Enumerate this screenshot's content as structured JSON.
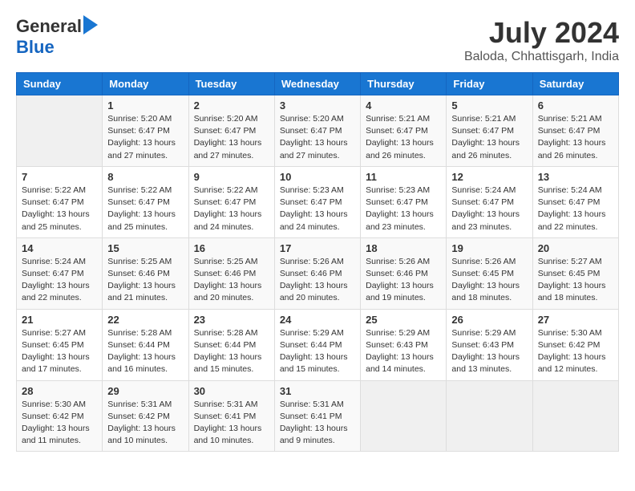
{
  "logo": {
    "general": "General",
    "blue": "Blue"
  },
  "title": {
    "month_year": "July 2024",
    "location": "Baloda, Chhattisgarh, India"
  },
  "calendar": {
    "headers": [
      "Sunday",
      "Monday",
      "Tuesday",
      "Wednesday",
      "Thursday",
      "Friday",
      "Saturday"
    ],
    "weeks": [
      [
        {
          "day": "",
          "sunrise": "",
          "sunset": "",
          "daylight": ""
        },
        {
          "day": "1",
          "sunrise": "Sunrise: 5:20 AM",
          "sunset": "Sunset: 6:47 PM",
          "daylight": "Daylight: 13 hours and 27 minutes."
        },
        {
          "day": "2",
          "sunrise": "Sunrise: 5:20 AM",
          "sunset": "Sunset: 6:47 PM",
          "daylight": "Daylight: 13 hours and 27 minutes."
        },
        {
          "day": "3",
          "sunrise": "Sunrise: 5:20 AM",
          "sunset": "Sunset: 6:47 PM",
          "daylight": "Daylight: 13 hours and 27 minutes."
        },
        {
          "day": "4",
          "sunrise": "Sunrise: 5:21 AM",
          "sunset": "Sunset: 6:47 PM",
          "daylight": "Daylight: 13 hours and 26 minutes."
        },
        {
          "day": "5",
          "sunrise": "Sunrise: 5:21 AM",
          "sunset": "Sunset: 6:47 PM",
          "daylight": "Daylight: 13 hours and 26 minutes."
        },
        {
          "day": "6",
          "sunrise": "Sunrise: 5:21 AM",
          "sunset": "Sunset: 6:47 PM",
          "daylight": "Daylight: 13 hours and 26 minutes."
        }
      ],
      [
        {
          "day": "7",
          "sunrise": "Sunrise: 5:22 AM",
          "sunset": "Sunset: 6:47 PM",
          "daylight": "Daylight: 13 hours and 25 minutes."
        },
        {
          "day": "8",
          "sunrise": "Sunrise: 5:22 AM",
          "sunset": "Sunset: 6:47 PM",
          "daylight": "Daylight: 13 hours and 25 minutes."
        },
        {
          "day": "9",
          "sunrise": "Sunrise: 5:22 AM",
          "sunset": "Sunset: 6:47 PM",
          "daylight": "Daylight: 13 hours and 24 minutes."
        },
        {
          "day": "10",
          "sunrise": "Sunrise: 5:23 AM",
          "sunset": "Sunset: 6:47 PM",
          "daylight": "Daylight: 13 hours and 24 minutes."
        },
        {
          "day": "11",
          "sunrise": "Sunrise: 5:23 AM",
          "sunset": "Sunset: 6:47 PM",
          "daylight": "Daylight: 13 hours and 23 minutes."
        },
        {
          "day": "12",
          "sunrise": "Sunrise: 5:24 AM",
          "sunset": "Sunset: 6:47 PM",
          "daylight": "Daylight: 13 hours and 23 minutes."
        },
        {
          "day": "13",
          "sunrise": "Sunrise: 5:24 AM",
          "sunset": "Sunset: 6:47 PM",
          "daylight": "Daylight: 13 hours and 22 minutes."
        }
      ],
      [
        {
          "day": "14",
          "sunrise": "Sunrise: 5:24 AM",
          "sunset": "Sunset: 6:47 PM",
          "daylight": "Daylight: 13 hours and 22 minutes."
        },
        {
          "day": "15",
          "sunrise": "Sunrise: 5:25 AM",
          "sunset": "Sunset: 6:46 PM",
          "daylight": "Daylight: 13 hours and 21 minutes."
        },
        {
          "day": "16",
          "sunrise": "Sunrise: 5:25 AM",
          "sunset": "Sunset: 6:46 PM",
          "daylight": "Daylight: 13 hours and 20 minutes."
        },
        {
          "day": "17",
          "sunrise": "Sunrise: 5:26 AM",
          "sunset": "Sunset: 6:46 PM",
          "daylight": "Daylight: 13 hours and 20 minutes."
        },
        {
          "day": "18",
          "sunrise": "Sunrise: 5:26 AM",
          "sunset": "Sunset: 6:46 PM",
          "daylight": "Daylight: 13 hours and 19 minutes."
        },
        {
          "day": "19",
          "sunrise": "Sunrise: 5:26 AM",
          "sunset": "Sunset: 6:45 PM",
          "daylight": "Daylight: 13 hours and 18 minutes."
        },
        {
          "day": "20",
          "sunrise": "Sunrise: 5:27 AM",
          "sunset": "Sunset: 6:45 PM",
          "daylight": "Daylight: 13 hours and 18 minutes."
        }
      ],
      [
        {
          "day": "21",
          "sunrise": "Sunrise: 5:27 AM",
          "sunset": "Sunset: 6:45 PM",
          "daylight": "Daylight: 13 hours and 17 minutes."
        },
        {
          "day": "22",
          "sunrise": "Sunrise: 5:28 AM",
          "sunset": "Sunset: 6:44 PM",
          "daylight": "Daylight: 13 hours and 16 minutes."
        },
        {
          "day": "23",
          "sunrise": "Sunrise: 5:28 AM",
          "sunset": "Sunset: 6:44 PM",
          "daylight": "Daylight: 13 hours and 15 minutes."
        },
        {
          "day": "24",
          "sunrise": "Sunrise: 5:29 AM",
          "sunset": "Sunset: 6:44 PM",
          "daylight": "Daylight: 13 hours and 15 minutes."
        },
        {
          "day": "25",
          "sunrise": "Sunrise: 5:29 AM",
          "sunset": "Sunset: 6:43 PM",
          "daylight": "Daylight: 13 hours and 14 minutes."
        },
        {
          "day": "26",
          "sunrise": "Sunrise: 5:29 AM",
          "sunset": "Sunset: 6:43 PM",
          "daylight": "Daylight: 13 hours and 13 minutes."
        },
        {
          "day": "27",
          "sunrise": "Sunrise: 5:30 AM",
          "sunset": "Sunset: 6:42 PM",
          "daylight": "Daylight: 13 hours and 12 minutes."
        }
      ],
      [
        {
          "day": "28",
          "sunrise": "Sunrise: 5:30 AM",
          "sunset": "Sunset: 6:42 PM",
          "daylight": "Daylight: 13 hours and 11 minutes."
        },
        {
          "day": "29",
          "sunrise": "Sunrise: 5:31 AM",
          "sunset": "Sunset: 6:42 PM",
          "daylight": "Daylight: 13 hours and 10 minutes."
        },
        {
          "day": "30",
          "sunrise": "Sunrise: 5:31 AM",
          "sunset": "Sunset: 6:41 PM",
          "daylight": "Daylight: 13 hours and 10 minutes."
        },
        {
          "day": "31",
          "sunrise": "Sunrise: 5:31 AM",
          "sunset": "Sunset: 6:41 PM",
          "daylight": "Daylight: 13 hours and 9 minutes."
        },
        {
          "day": "",
          "sunrise": "",
          "sunset": "",
          "daylight": ""
        },
        {
          "day": "",
          "sunrise": "",
          "sunset": "",
          "daylight": ""
        },
        {
          "day": "",
          "sunrise": "",
          "sunset": "",
          "daylight": ""
        }
      ]
    ]
  }
}
